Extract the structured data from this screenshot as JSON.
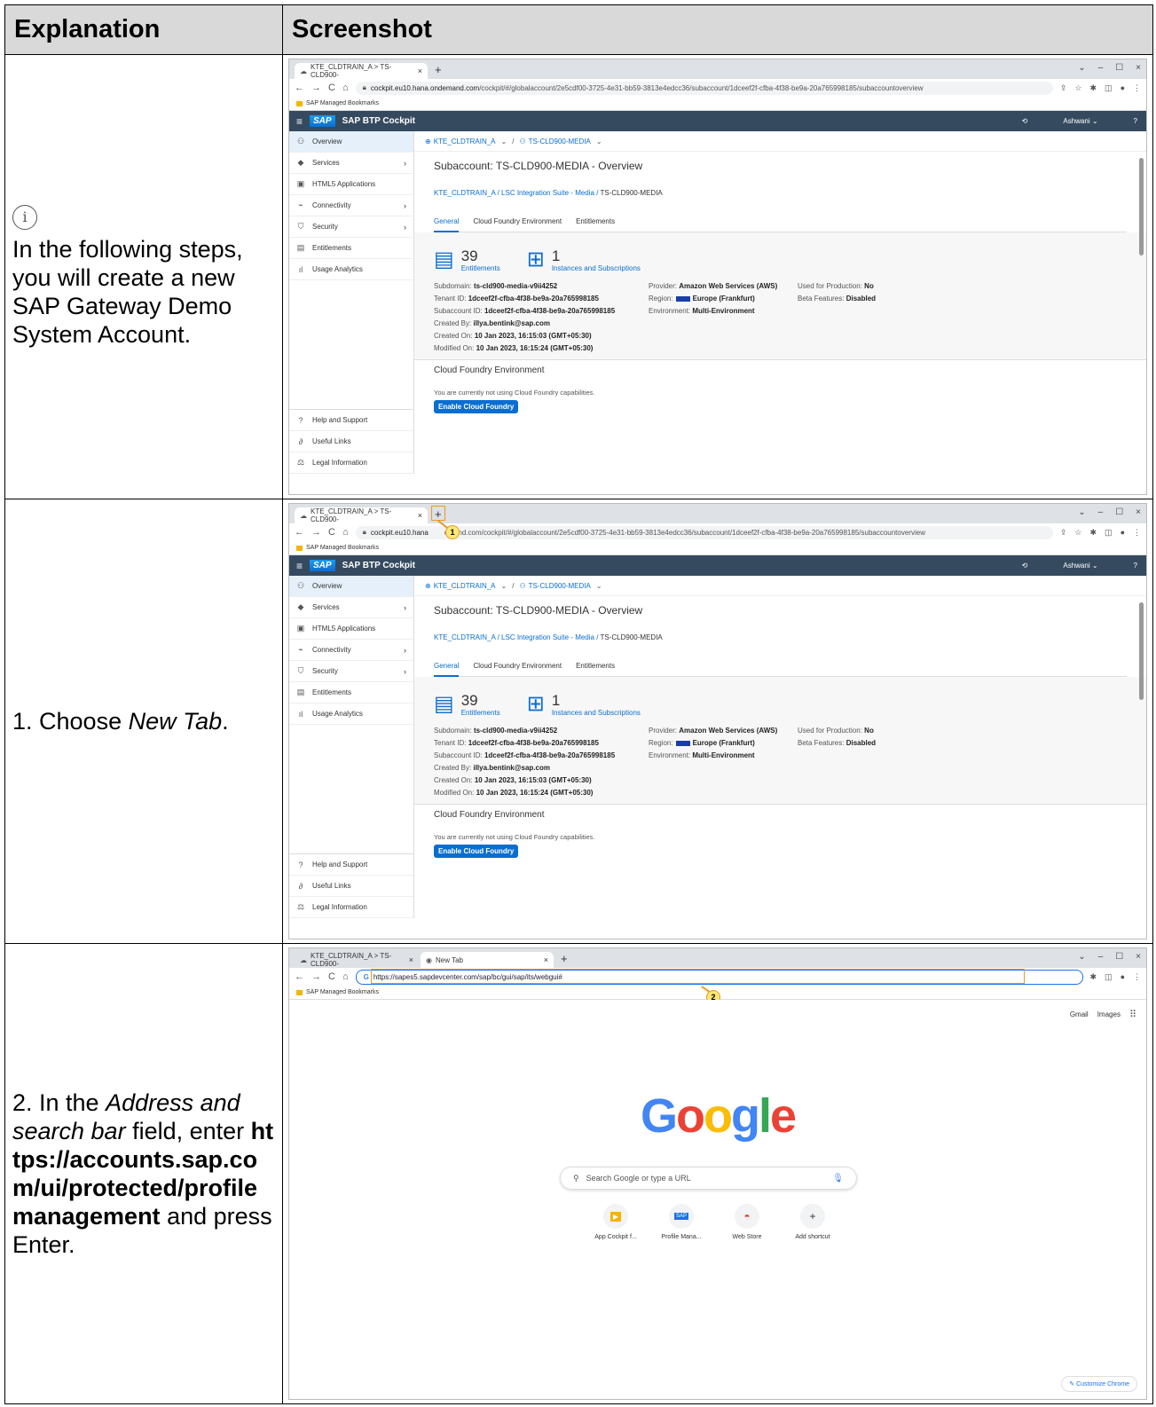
{
  "table": {
    "col1_header": "Explanation",
    "col2_header": "Screenshot"
  },
  "rows": [
    {
      "info_icon": "i",
      "text": "In the following steps, you will create a new SAP Gateway Demo System Account."
    },
    {
      "text_prefix": "1. Choose ",
      "text_em": "New Tab",
      "text_suffix": "."
    },
    {
      "text_prefix": "2. In the ",
      "text_em": "Address and search bar",
      "text_mid": " field, enter ",
      "text_bold": "https://accounts.sap.com/ui/protected/profilemanagement",
      "text_suffix": " and press Enter."
    }
  ],
  "browser": {
    "tab_title": "KTE_CLDTRAIN_A > TS-CLD900-",
    "new_tab_title": "New Tab",
    "url_host": "cockpit.eu10.hana.ondemand.com",
    "url_path": "/cockpit/#/globalaccount/2e5cdf00-3725-4e31-bb59-3813e4edcc36/subaccount/1dceef2f-cfba-4f38-be9a-20a765998185/subaccountoverview",
    "url_path_step1": "emand.com/cockpit/#/globalaccount/2e5cdf00-3725-4e31-bb59-3813e4edcc36/subaccount/1dceef2f-cfba-4f38-be9a-20a765998185/subaccountoverview",
    "url_host_step1": "cockpit.eu10.hana",
    "url_step2": "https://sapes5.sapdevcenter.com/sap/bc/gui/sap/its/webgui#",
    "bookmarks": "SAP Managed Bookmarks"
  },
  "sap": {
    "logo": "SAP",
    "product": "SAP BTP Cockpit",
    "user": "Ashwani",
    "sidebar": [
      "Overview",
      "Services",
      "HTML5 Applications",
      "Connectivity",
      "Security",
      "Entitlements",
      "Usage Analytics"
    ],
    "sidebar_bottom": [
      "Help and Support",
      "Useful Links",
      "Legal Information"
    ],
    "crumb_global": "KTE_CLDTRAIN_A",
    "crumb_sub": "TS-CLD900-MEDIA",
    "title": "Subaccount: TS-CLD900-MEDIA - Overview",
    "breadcrumb_1": "KTE_CLDTRAIN_A",
    "breadcrumb_2": "LSC Integration Suite - Media",
    "breadcrumb_3": "TS-CLD900-MEDIA",
    "tabs": [
      "General",
      "Cloud Foundry Environment",
      "Entitlements"
    ],
    "stat1_num": "39",
    "stat1_lbl": "Entitlements",
    "stat2_num": "1",
    "stat2_lbl": "Instances and Subscriptions",
    "props": {
      "subdomain_lbl": "Subdomain:",
      "subdomain": "ts-cld900-media-v9ii4252",
      "provider_lbl": "Provider:",
      "provider": "Amazon Web Services (AWS)",
      "production_lbl": "Used for Production:",
      "production": "No",
      "tenant_lbl": "Tenant ID:",
      "tenant": "1dceef2f-cfba-4f38-be9a-20a765998185",
      "region_lbl": "Region:",
      "region": "Europe (Frankfurt)",
      "beta_lbl": "Beta Features:",
      "beta": "Disabled",
      "subid_lbl": "Subaccount ID:",
      "subid": "1dceef2f-cfba-4f38-be9a-20a765998185",
      "env_lbl": "Environment:",
      "env": "Multi-Environment",
      "createdby_lbl": "Created By:",
      "createdby": "illya.bentink@sap.com",
      "createdon_lbl": "Created On:",
      "createdon": "10 Jan 2023, 16:15:03 (GMT+05:30)",
      "modified_lbl": "Modified On:",
      "modified": "10 Jan 2023, 16:15:24 (GMT+05:30)"
    },
    "cf_title": "Cloud Foundry Environment",
    "cf_text": "You are currently not using Cloud Foundry capabilities.",
    "cf_button": "Enable Cloud Foundry"
  },
  "callouts": [
    "1",
    "2"
  ],
  "google": {
    "gmail": "Gmail",
    "images": "Images",
    "logo": "Google",
    "search_placeholder": "Search Google or type a URL",
    "shortcuts": [
      "App Cockpit f...",
      "Profile Mana...",
      "Web Store",
      "Add shortcut"
    ],
    "customize": "Customize Chrome",
    "logo_colors": [
      "#4285f4",
      "#ea4335",
      "#fbbc05",
      "#4285f4",
      "#34a853",
      "#ea4335"
    ]
  }
}
